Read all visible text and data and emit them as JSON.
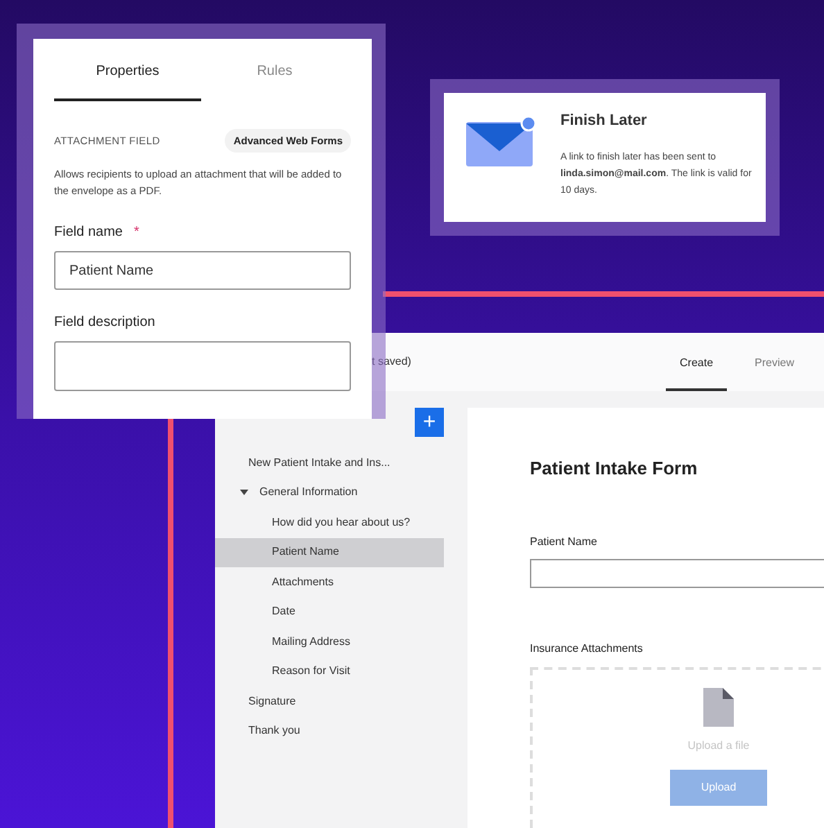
{
  "properties_panel": {
    "tabs": [
      {
        "label": "Properties",
        "selected": true
      },
      {
        "label": "Rules",
        "selected": false
      }
    ],
    "section_label": "ATTACHMENT FIELD",
    "badge": "Advanced Web Forms",
    "description": "Allows recipients to upload an attachment that will be added to the envelope as a PDF.",
    "fields": [
      {
        "label": "Field name",
        "required_mark": "*",
        "value": "Patient Name"
      },
      {
        "label": "Field description"
      }
    ]
  },
  "notification": {
    "title": "Finish Later",
    "message": "A link to finish later has been sent to **linda.simon@mail.com**. The link is valid for 10 days.",
    "unread": true
  },
  "editor": {
    "save_status": "t saved)",
    "tabs": [
      {
        "label": "Create",
        "selected": true
      },
      {
        "label": "Preview",
        "selected": false
      }
    ],
    "add_button": "+",
    "outline": [
      {
        "label": "New Patient Intake and Ins...",
        "selected": false
      },
      {
        "label": "General Information",
        "expanded": true,
        "selected": false,
        "children": [
          {
            "label": "How did you hear about us?",
            "selected": false
          },
          {
            "label": "Patient Name",
            "selected": true
          },
          {
            "label": "Attachments",
            "selected": false
          },
          {
            "label": "Date",
            "selected": false
          },
          {
            "label": "Mailing Address",
            "selected": false
          },
          {
            "label": "Reason for Visit",
            "selected": false
          }
        ]
      },
      {
        "label": "Signature",
        "selected": false
      },
      {
        "label": "Thank you",
        "selected": false
      }
    ],
    "form": {
      "title": "Patient Intake Form",
      "field_label": "Patient Name",
      "attachments_label": "Insurance Attachments",
      "upload_hint": "Upload a file",
      "upload_button": "Upload"
    }
  }
}
